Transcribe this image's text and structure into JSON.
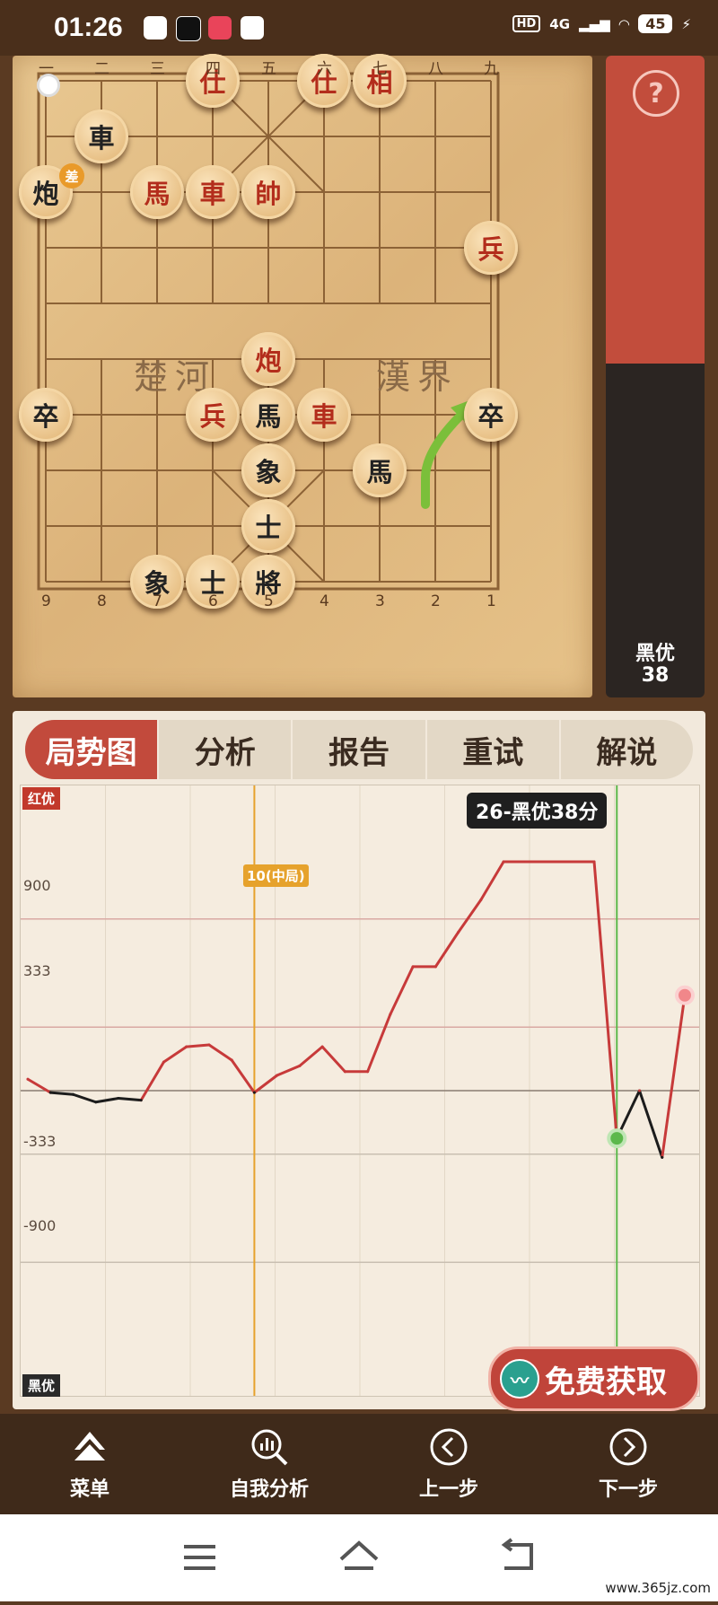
{
  "status_bar": {
    "time": "01:26",
    "hd": "HD",
    "network": "4G",
    "battery": "45"
  },
  "board": {
    "top_files": [
      "一",
      "二",
      "三",
      "四",
      "五",
      "六",
      "七",
      "八",
      "九"
    ],
    "bottom_files": [
      "9",
      "8",
      "7",
      "6",
      "5",
      "4",
      "3",
      "2",
      "1"
    ],
    "river_left": "楚河",
    "river_right": "漢界",
    "diff_badge": "差",
    "pieces": [
      {
        "char": "仕",
        "side": "red",
        "col": 3,
        "row": 0
      },
      {
        "char": "仕",
        "side": "red",
        "col": 5,
        "row": 0
      },
      {
        "char": "相",
        "side": "red",
        "col": 6,
        "row": 0
      },
      {
        "char": "車",
        "side": "black",
        "col": 1,
        "row": 1
      },
      {
        "char": "炮",
        "side": "black",
        "col": 0,
        "row": 2
      },
      {
        "char": "馬",
        "side": "red",
        "col": 2,
        "row": 2
      },
      {
        "char": "車",
        "side": "red",
        "col": 3,
        "row": 2
      },
      {
        "char": "帥",
        "side": "red",
        "col": 4,
        "row": 2
      },
      {
        "char": "兵",
        "side": "red",
        "col": 8,
        "row": 3
      },
      {
        "char": "炮",
        "side": "red",
        "col": 4,
        "row": 5
      },
      {
        "char": "卒",
        "side": "black",
        "col": 0,
        "row": 6
      },
      {
        "char": "兵",
        "side": "red",
        "col": 3,
        "row": 6
      },
      {
        "char": "馬",
        "side": "black",
        "col": 4,
        "row": 6
      },
      {
        "char": "車",
        "side": "red",
        "col": 5,
        "row": 6
      },
      {
        "char": "卒",
        "side": "black",
        "col": 8,
        "row": 6
      },
      {
        "char": "象",
        "side": "black",
        "col": 4,
        "row": 7
      },
      {
        "char": "馬",
        "side": "black",
        "col": 6,
        "row": 7
      },
      {
        "char": "士",
        "side": "black",
        "col": 4,
        "row": 8
      },
      {
        "char": "象",
        "side": "black",
        "col": 2,
        "row": 9
      },
      {
        "char": "士",
        "side": "black",
        "col": 3,
        "row": 9
      },
      {
        "char": "將",
        "side": "black",
        "col": 4,
        "row": 9
      }
    ]
  },
  "eval_bar": {
    "red_fraction": 0.48,
    "label": "黑优",
    "score": "38"
  },
  "tabs": [
    {
      "label": "局势图",
      "active": true
    },
    {
      "label": "分析",
      "active": false
    },
    {
      "label": "报告",
      "active": false
    },
    {
      "label": "重试",
      "active": false
    },
    {
      "label": "解说",
      "active": false
    }
  ],
  "chart": {
    "red_tag": "红优",
    "black_tag": "黑优",
    "callout": "26-黑优38分",
    "phase_tag": "10(中局)",
    "y_labels": [
      "900",
      "333",
      "-333",
      "-900"
    ]
  },
  "chart_data": {
    "type": "line",
    "yticks": [
      900,
      333,
      0,
      -333,
      -900
    ],
    "ylim": [
      -1600,
      1600
    ],
    "x": [
      0,
      1,
      2,
      3,
      4,
      5,
      6,
      7,
      8,
      9,
      10,
      11,
      12,
      13,
      14,
      15,
      16,
      17,
      18,
      19,
      20,
      21,
      22,
      23,
      24,
      25,
      26,
      27,
      28,
      29
    ],
    "series": [
      {
        "values": [
          60,
          -10,
          -20,
          -60,
          -40,
          -50,
          150,
          230,
          240,
          160,
          -10,
          80,
          130,
          230,
          100,
          100,
          400,
          650,
          650,
          830,
          1000,
          1200,
          1200,
          1200,
          1200,
          1200,
          -250,
          0,
          -350,
          500
        ]
      }
    ],
    "markers": {
      "phase_x": 10,
      "current_x": 26
    }
  },
  "free_button": {
    "label": "免费获取"
  },
  "bottom_nav": [
    {
      "label": "菜单",
      "icon": "menu-icon"
    },
    {
      "label": "自我分析",
      "icon": "analysis-search-icon"
    },
    {
      "label": "上一步",
      "icon": "prev-step-icon"
    },
    {
      "label": "下一步",
      "icon": "next-step-icon"
    }
  ],
  "watermark": "www.365jz.com"
}
